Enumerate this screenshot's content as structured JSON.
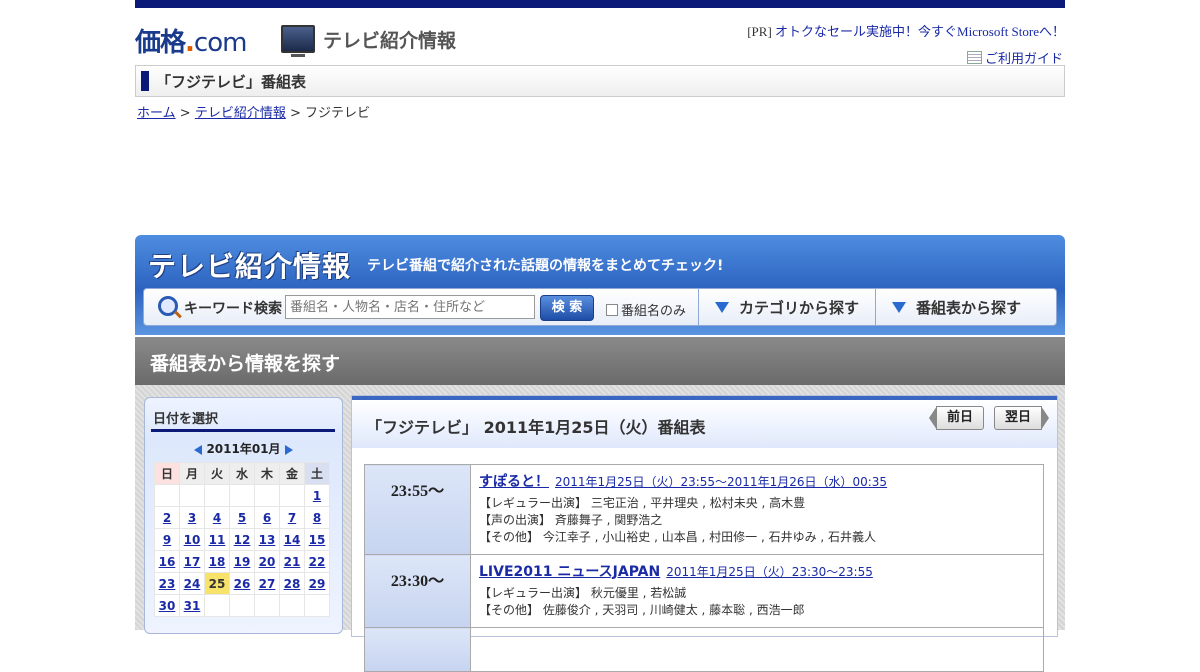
{
  "header": {
    "logo_main": "価格",
    "logo_dot": ".",
    "logo_com": "com",
    "section_title": "テレビ紹介情報",
    "pr_tag": "[PR]",
    "pr_link": "オトクなセール実施中！今すぐMicrosoft Storeへ！",
    "guide_link": "ご利用ガイド"
  },
  "page_title": "「フジテレビ」番組表",
  "breadcrumb": {
    "home": "ホーム",
    "sep1": ">",
    "section": "テレビ紹介情報",
    "sep2": ">",
    "current": "フジテレビ"
  },
  "banner": {
    "title": "テレビ紹介情報",
    "subtitle": "テレビ番組で紹介された話題の情報をまとめてチェック!",
    "keyword_label": "キーワード検索",
    "search_placeholder": "番組名・人物名・店名・住所など",
    "search_button": "検 索",
    "checkbox_label": "番組名のみ",
    "tab_category": "カテゴリから探す",
    "tab_schedule": "番組表から探す"
  },
  "section_heading": "番組表から情報を探す",
  "calendar": {
    "title": "日付を選択",
    "month": "2011年01月",
    "weekdays": [
      "日",
      "月",
      "火",
      "水",
      "木",
      "金",
      "土"
    ],
    "weeks": [
      [
        "",
        "",
        "",
        "",
        "",
        "",
        "1"
      ],
      [
        "2",
        "3",
        "4",
        "5",
        "6",
        "7",
        "8"
      ],
      [
        "9",
        "10",
        "11",
        "12",
        "13",
        "14",
        "15"
      ],
      [
        "16",
        "17",
        "18",
        "19",
        "20",
        "21",
        "22"
      ],
      [
        "23",
        "24",
        "25",
        "26",
        "27",
        "28",
        "29"
      ],
      [
        "30",
        "31",
        "",
        "",
        "",
        "",
        ""
      ]
    ],
    "selected_day": "25"
  },
  "schedule": {
    "heading": "「フジテレビ」 2011年1月25日（火）番組表",
    "prev_label": "前日",
    "next_label": "翌日",
    "programs": [
      {
        "time": "23:55～",
        "title": "すぽると！",
        "date": "2011年1月25日（火）23:55～2011年1月26日（水）00:35",
        "lines": [
          "【レギュラー出演】 三宅正治 , 平井理央 , 松村未央 , 高木豊",
          "【声の出演】 斉藤舞子 , 関野浩之",
          "【その他】 今江幸子 , 小山裕史 , 山本昌 , 村田修一 , 石井ゆみ , 石井義人"
        ]
      },
      {
        "time": "23:30～",
        "title": "LIVE2011 ニュースJAPAN",
        "date": "2011年1月25日（火）23:30～23:55",
        "lines": [
          "【レギュラー出演】 秋元優里 , 若松誠",
          "【その他】 佐藤俊介 , 天羽司 , 川崎健太 , 藤本聡 , 西浩一郎"
        ]
      }
    ]
  }
}
